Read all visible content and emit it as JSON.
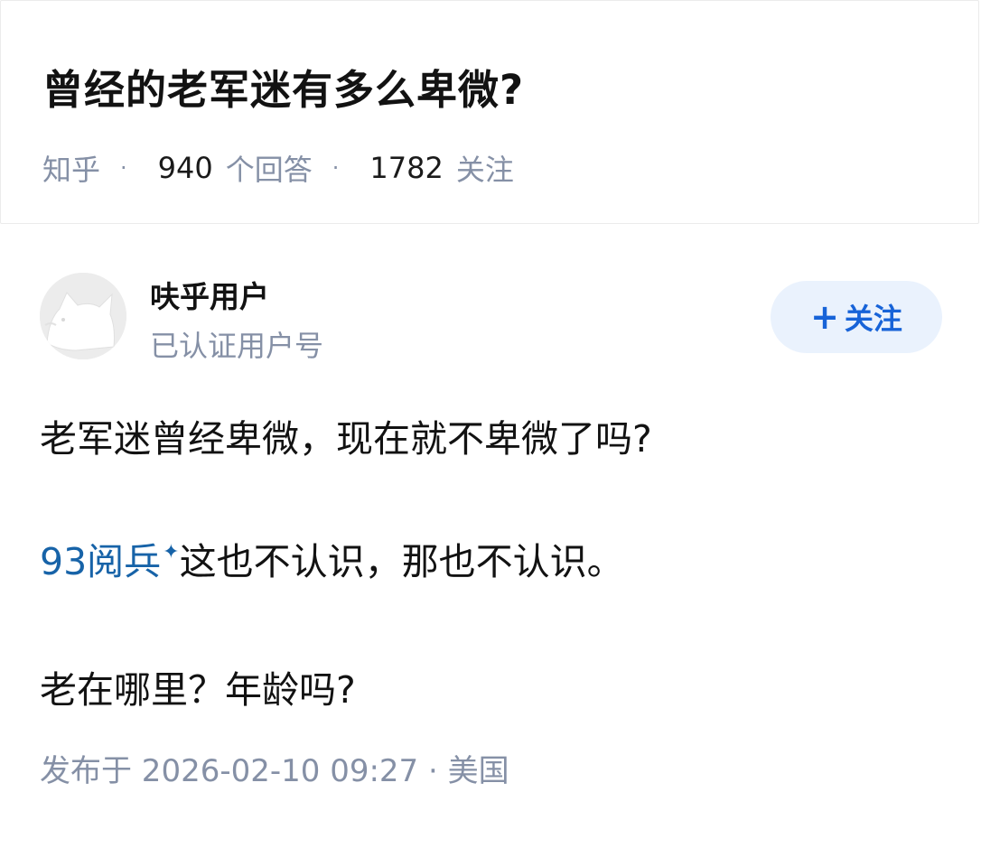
{
  "question": {
    "title": "曾经的老军迷有多么卑微?",
    "source": "知乎",
    "answer_count": "940",
    "answer_label": "个回答",
    "follower_count": "1782",
    "follower_label": "关注"
  },
  "answer": {
    "author": {
      "name": "呋乎用户",
      "badge": "已认证用户号",
      "avatar_icon": "default-avatar-icon"
    },
    "follow_button": {
      "plus": "+",
      "label": "关注"
    },
    "paragraphs": {
      "p1": "老军迷曾经卑微，现在就不卑微了吗?",
      "p2_link": "93阅兵",
      "p2_link_icon": "sparkle-icon",
      "p2_rest": "这也不认识，那也不认识。",
      "p3": "老在哪里？年龄吗?"
    },
    "publish": {
      "text": "发布于 2026-02-10 09:27 · 美国"
    }
  },
  "colors": {
    "link": "#1763a8",
    "follow_text": "#1763d8",
    "follow_bg": "#eaf2fd",
    "meta": "#8590a6"
  }
}
